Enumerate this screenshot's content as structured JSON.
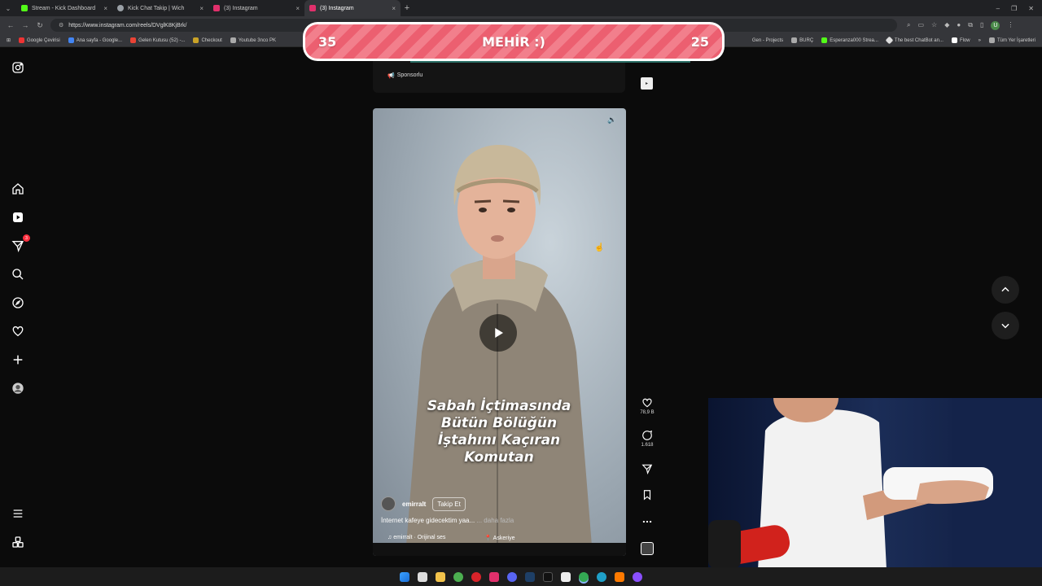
{
  "browser": {
    "tabs": [
      {
        "title": "Stream - Kick Dashboard",
        "color": "#53fc18",
        "active": false
      },
      {
        "title": "Kick Chat Takip | Wich",
        "color": "#9aa0a6",
        "active": false
      },
      {
        "title": "(3) Instagram",
        "color": "#e1306c",
        "active": false
      },
      {
        "title": "(3) Instagram",
        "color": "#e1306c",
        "active": true
      }
    ],
    "url": "https://www.instagram.com/reels/DVglK8KjBrk/",
    "bookmarks": [
      "Google Çevirisi",
      "Ana sayfa - Google...",
      "Gelen Kutusu (52) -...",
      "Checkout",
      "Youtube 3nco PK"
    ],
    "bookmarks_right": [
      "Gen - Projects",
      "BURÇ",
      "Esperanza000 Strea...",
      "The best ChatBot an...",
      "Flow"
    ],
    "all_bookmarks": "Tüm Yer İşaretleri"
  },
  "overlay": {
    "left_value": "35",
    "title": "MEHİR :)",
    "right_value": "25"
  },
  "sidebar": {
    "notification_badge": "3",
    "icons": [
      "instagram-logo-icon",
      "home-icon",
      "reels-icon",
      "direct-messages-icon",
      "search-icon",
      "explore-icon",
      "heart-icon",
      "create-icon",
      "profile-icon",
      "menu-icon",
      "also-from-meta-icon"
    ]
  },
  "sponsored": {
    "label": "Sponsorlu"
  },
  "reel": {
    "caption": "Sabah İçtimasında\nBütün Bölüğün\nİştahını Kaçıran\nKomutan",
    "author": "emirralt",
    "follow_label": "Takip Et",
    "description": "İnternet kafeye gidecektim yaa...",
    "more_label": "... daha fazla",
    "audio": "emirralt · Orijinal ses",
    "location": "Askeriye"
  },
  "actions": {
    "likes": "78,9 B",
    "comments": "1.618"
  }
}
